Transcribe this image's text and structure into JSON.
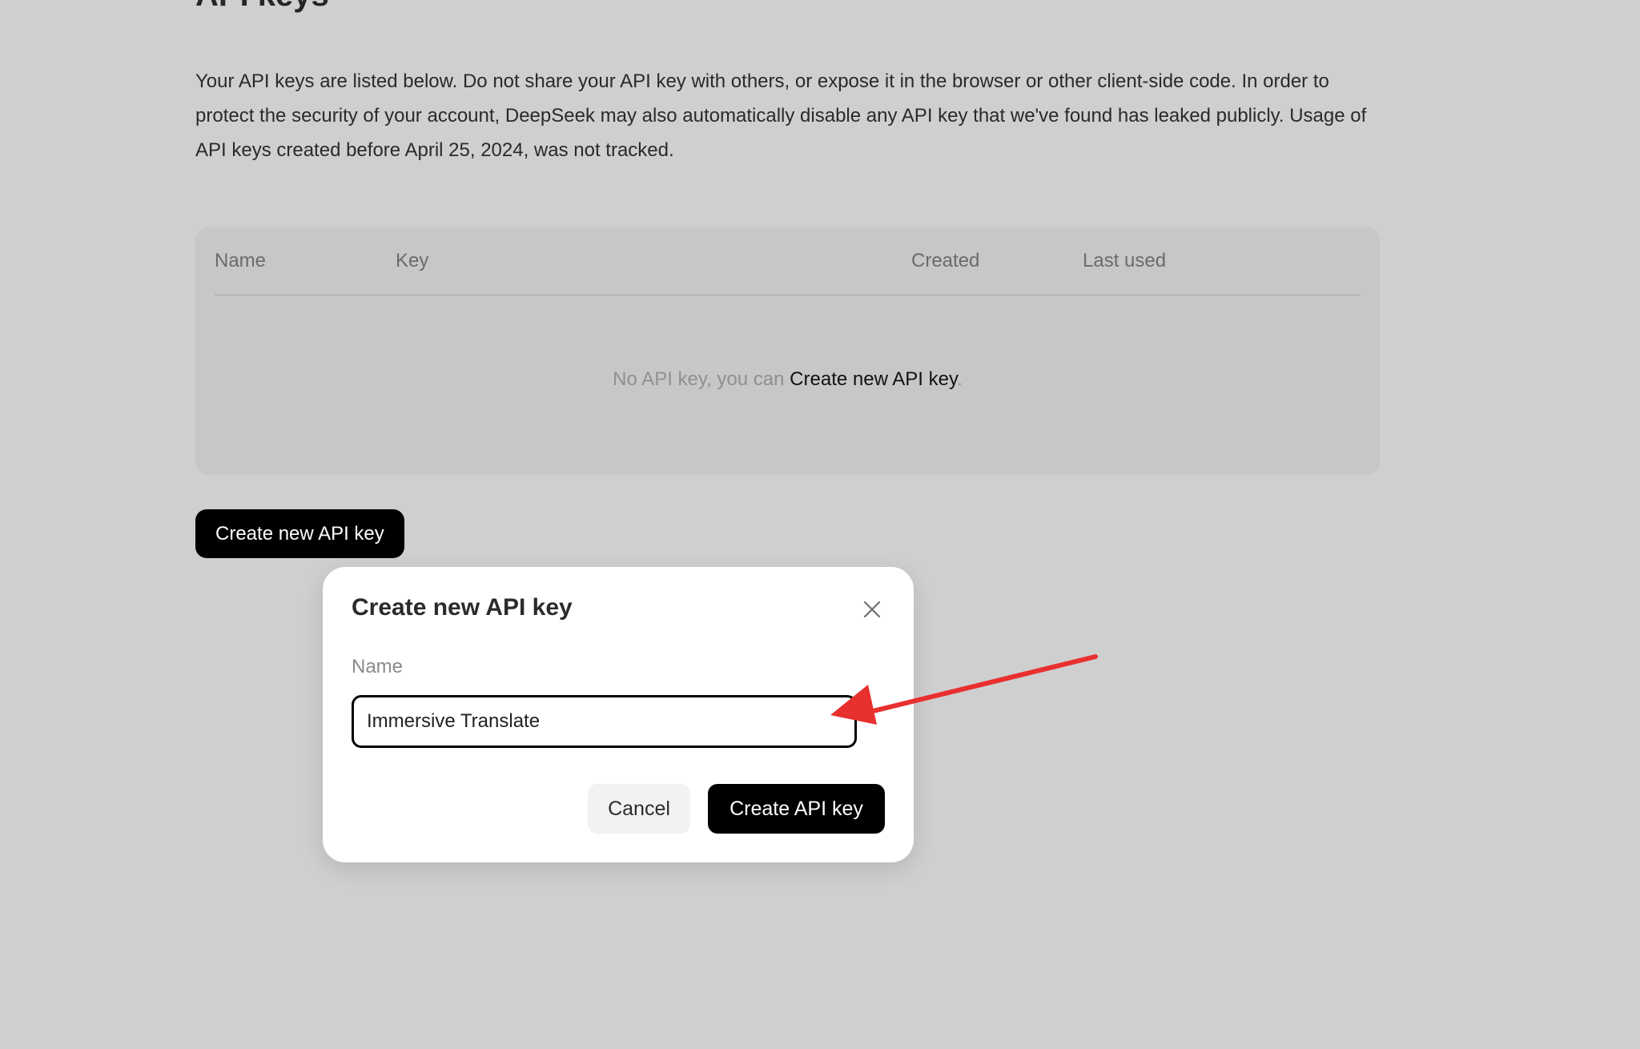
{
  "page": {
    "title": "API keys",
    "description": "Your API keys are listed below. Do not share your API key with others, or expose it in the browser or other client-side code. In order to protect the security of your account, DeepSeek may also automatically disable any API key that we've found has leaked publicly. Usage of API keys created before April 25, 2024, was not tracked."
  },
  "table": {
    "columns": [
      "Name",
      "Key",
      "Created",
      "Last used"
    ],
    "empty_prefix": "No API key, you can ",
    "empty_link": "Create new API key",
    "empty_suffix": "."
  },
  "create_button_label": "Create new API key",
  "modal": {
    "title": "Create new API key",
    "name_label": "Name",
    "name_value": "Immersive Translate",
    "cancel_label": "Cancel",
    "submit_label": "Create API key"
  },
  "colors": {
    "annotation_arrow": "#e8302f",
    "overlay_bg": "#cfcfcf",
    "primary_button": "#000000"
  }
}
